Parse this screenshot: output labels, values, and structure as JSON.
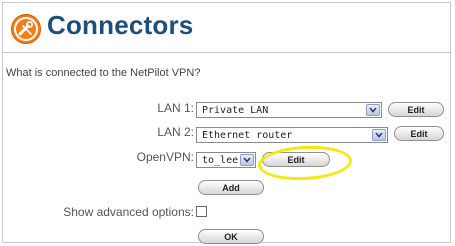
{
  "header": {
    "title": "Connectors",
    "icon": "tools-icon",
    "accent_color": "#f07e1b",
    "title_color": "#1f4e7a"
  },
  "question": "What is connected to the NetPilot VPN?",
  "rows": {
    "lan1": {
      "label": "LAN 1:",
      "value": "Private LAN",
      "button": "Edit"
    },
    "lan2": {
      "label": "LAN 2:",
      "value": "Ethernet router",
      "button": "Edit"
    },
    "openvpn": {
      "label": "OpenVPN:",
      "value": "to_lee",
      "button": "Edit"
    }
  },
  "add_button": "Add",
  "advanced": {
    "label": "Show advanced options:",
    "checked": false
  },
  "ok_button": "OK",
  "annotation": {
    "shape": "ellipse",
    "color": "#f2e812",
    "target": "openvpn edit button"
  }
}
